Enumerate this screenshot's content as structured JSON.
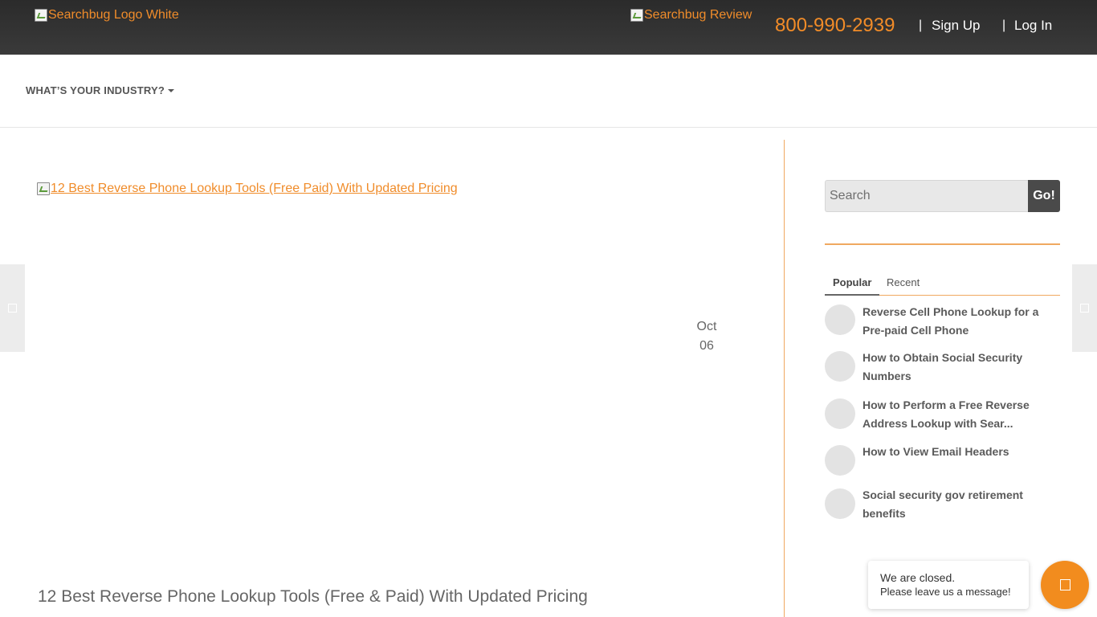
{
  "header": {
    "logo_alt": "Searchbug Logo White",
    "review_alt": "Searchbug Review",
    "phone": "800-990-2939",
    "separator": "|",
    "signup_label": "Sign Up",
    "login_label": "Log In"
  },
  "nav": {
    "industry_label": "WHAT’S YOUR INDUSTRY?"
  },
  "post": {
    "image_alt": "12 Best Reverse Phone Lookup Tools (Free Paid) With Updated Pricing",
    "date_month": "Oct",
    "date_day": "06",
    "title": "12 Best Reverse Phone Lookup Tools (Free & Paid) With Updated Pricing"
  },
  "sidebar": {
    "search_placeholder": "Search",
    "go_label": "Go!",
    "tabs": [
      "Popular",
      "Recent"
    ],
    "popular_items": [
      "Reverse Cell Phone Lookup for a Pre-paid Cell Phone",
      "How to Obtain Social Security Numbers",
      "How to Perform a Free Reverse Address Lookup with Sear...",
      "How to View Email Headers",
      "Social security gov retirement benefits"
    ]
  },
  "chat": {
    "line1": "We are closed.",
    "line2": "Please leave us a message!"
  },
  "colors": {
    "accent": "#f28c28",
    "topbar": "#333333",
    "divider": "#f0a860"
  }
}
